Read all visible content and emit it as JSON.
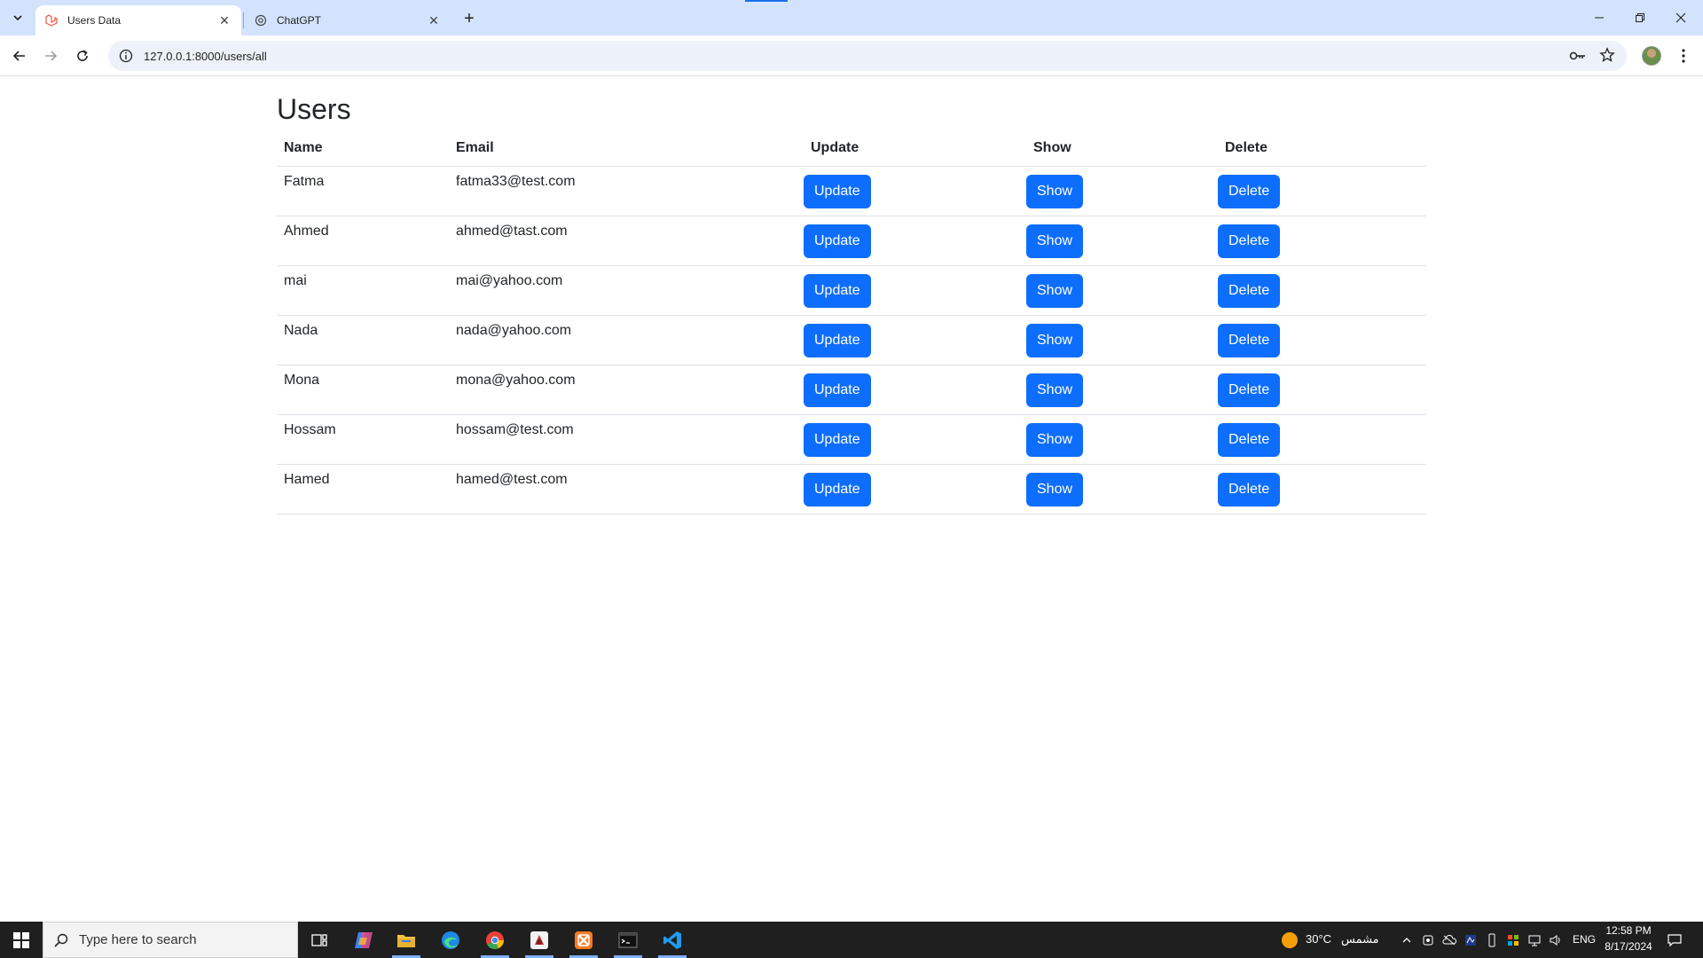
{
  "browser": {
    "tabs": [
      {
        "title": "Users Data",
        "active": true
      },
      {
        "title": "ChatGPT",
        "active": false
      }
    ],
    "new_tab_label": "+",
    "url": "127.0.0.1:8000/users/all"
  },
  "page": {
    "title": "Users",
    "table": {
      "headers": {
        "name": "Name",
        "email": "Email",
        "update": "Update",
        "show": "Show",
        "delete": "Delete"
      },
      "rows": [
        {
          "name": "Fatma",
          "email": "fatma33@test.com",
          "update": "Update",
          "show": "Show",
          "delete": "Delete"
        },
        {
          "name": "Ahmed",
          "email": "ahmed@tast.com",
          "update": "Update",
          "show": "Show",
          "delete": "Delete"
        },
        {
          "name": "mai",
          "email": "mai@yahoo.com",
          "update": "Update",
          "show": "Show",
          "delete": "Delete"
        },
        {
          "name": "Nada",
          "email": "nada@yahoo.com",
          "update": "Update",
          "show": "Show",
          "delete": "Delete"
        },
        {
          "name": "Mona",
          "email": "mona@yahoo.com",
          "update": "Update",
          "show": "Show",
          "delete": "Delete"
        },
        {
          "name": "Hossam",
          "email": "hossam@test.com",
          "update": "Update",
          "show": "Show",
          "delete": "Delete"
        },
        {
          "name": "Hamed",
          "email": "hamed@test.com",
          "update": "Update",
          "show": "Show",
          "delete": "Delete"
        }
      ]
    },
    "colors": {
      "primary_button": "#0d6efd",
      "tabbar": "#d3e3fd",
      "taskbar": "#1f1f1f"
    }
  },
  "taskbar": {
    "search_placeholder": "Type here to search",
    "weather_temp": "30°C",
    "weather_text": "مشمس",
    "language": "ENG",
    "time": "12:58 PM",
    "date": "8/17/2024",
    "apps": [
      "task-view-icon",
      "copilot-icon",
      "file-explorer-icon",
      "edge-icon",
      "chrome-icon",
      "app-red-icon",
      "xampp-icon",
      "terminal-icon",
      "vscode-icon"
    ]
  }
}
